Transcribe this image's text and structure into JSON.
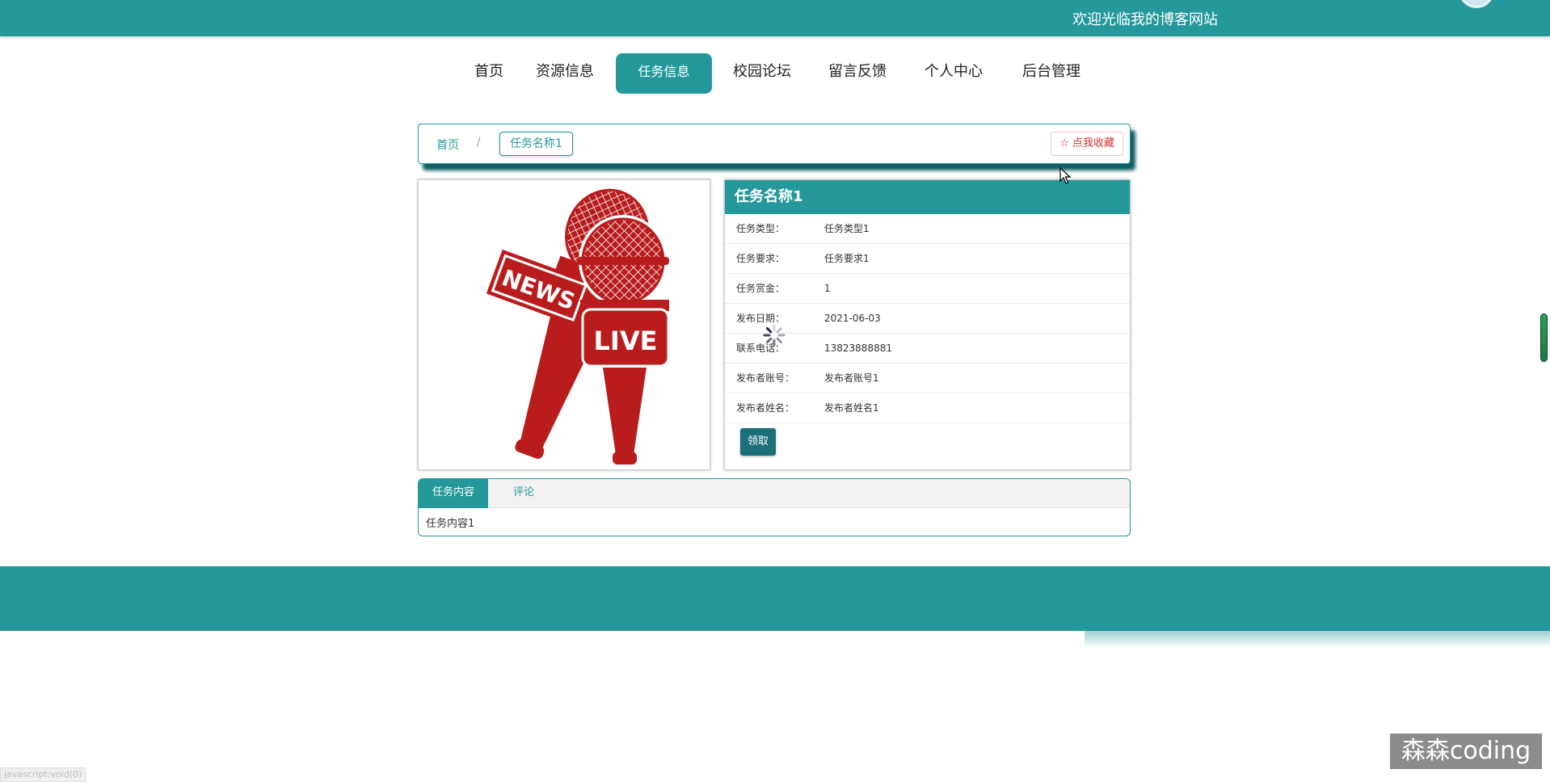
{
  "header": {
    "welcome": "欢迎光临我的博客网站"
  },
  "nav": {
    "items": [
      {
        "label": "首页",
        "active": false
      },
      {
        "label": "资源信息",
        "active": false
      },
      {
        "label": "任务信息",
        "active": true
      },
      {
        "label": "校园论坛",
        "active": false
      },
      {
        "label": "留言反馈",
        "active": false
      },
      {
        "label": "个人中心",
        "active": false
      },
      {
        "label": "后台管理",
        "active": false
      }
    ]
  },
  "breadcrumb": {
    "home": "首页",
    "separator": "/",
    "current": "任务名称1",
    "favorite": "☆ 点我收藏"
  },
  "detail": {
    "title": "任务名称1",
    "rows": [
      {
        "label": "任务类型：",
        "value": "任务类型1"
      },
      {
        "label": "任务要求：",
        "value": "任务要求1"
      },
      {
        "label": "任务赏金：",
        "value": "1"
      },
      {
        "label": "发布日期：",
        "value": "2021-06-03"
      },
      {
        "label": "联系电话：",
        "value": "13823888881"
      },
      {
        "label": "发布者账号：",
        "value": "发布者账号1"
      },
      {
        "label": "发布者姓名：",
        "value": "发布者姓名1"
      }
    ],
    "claim_button": "领取"
  },
  "image": {
    "news_text": "NEWS",
    "live_text": "LIVE"
  },
  "tabs": {
    "items": [
      {
        "label": "任务内容",
        "active": true
      },
      {
        "label": "评论",
        "active": false
      }
    ],
    "content": "任务内容1"
  },
  "status_bar": {
    "url": "javascript:void(0)"
  },
  "watermark": "森森coding",
  "colors": {
    "primary": "#24989a",
    "claim": "#1c6e78",
    "mic_red": "#b91c1c",
    "favorite": "#c9302c"
  }
}
